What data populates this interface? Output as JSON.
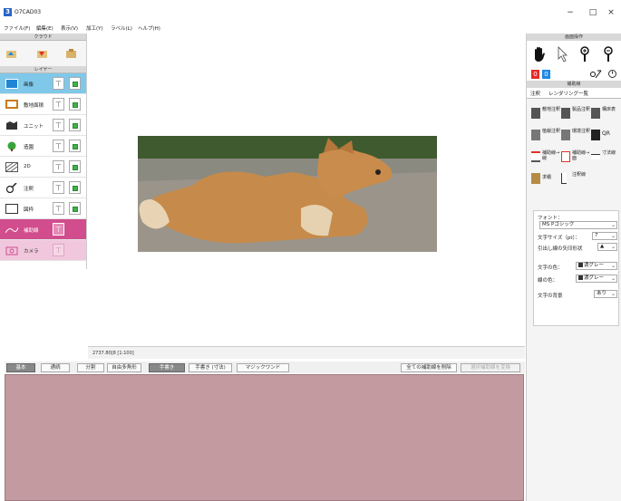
{
  "window": {
    "title": "O7CAD03",
    "icon_text": "3",
    "controls": {
      "minimize": "−",
      "maximize": "□",
      "close": "×"
    }
  },
  "menu": [
    "ファイル(F)",
    "編集(E)",
    "表示(V)",
    "加工(Y)",
    "ラベル(L)",
    "ヘルプ(H)"
  ],
  "left_panel": {
    "cloud_header": "クラウド",
    "cloud_icons": [
      "cloud-upload-icon",
      "cloud-download-icon",
      "cloud-box-icon"
    ],
    "layer_header": "レイヤー",
    "layers": [
      {
        "label": "画像",
        "icon": "image-layer-icon",
        "state": "selected-blue"
      },
      {
        "label": "敷地面積",
        "icon": "site-area-icon",
        "state": "normal"
      },
      {
        "label": "ユニット",
        "icon": "unit-icon",
        "state": "normal"
      },
      {
        "label": "造園",
        "icon": "landscape-icon",
        "state": "normal"
      },
      {
        "label": "2D",
        "icon": "2d-icon",
        "state": "normal"
      },
      {
        "label": "注釈",
        "icon": "annotation-icon",
        "state": "normal"
      },
      {
        "label": "図枠",
        "icon": "frame-icon",
        "state": "normal"
      },
      {
        "label": "補助線",
        "icon": "aux-line-icon",
        "state": "selected-pink"
      },
      {
        "label": "カメラ",
        "icon": "camera-icon",
        "state": "pink-light"
      }
    ],
    "layer_tool_glyph": "⊤"
  },
  "status_bar": {
    "text": "2737.80[8 [1:100]"
  },
  "bottom_toolbar": [
    {
      "label": "基本",
      "style": "dark"
    },
    {
      "label": "通続",
      "style": "normal"
    },
    {
      "label": "分割",
      "style": "normal"
    },
    {
      "label": "自由多角形",
      "style": "normal"
    },
    {
      "label": "手書き",
      "style": "dark"
    },
    {
      "label": "手書き (寸法)",
      "style": "normal"
    },
    {
      "label": "マジックワンド",
      "style": "normal"
    },
    {
      "label": "全ての補助線を削除",
      "style": "normal"
    },
    {
      "label": "選択補助線を変換",
      "style": "disabled"
    }
  ],
  "right_panel": {
    "screen_ops_header": "画面操作",
    "screen_ops": [
      "hand-icon",
      "pointer-icon",
      "zoom-in-icon",
      "zoom-out-icon"
    ],
    "num_badges": [
      {
        "value": "0",
        "color": "#e52a2a"
      },
      {
        "value": "0",
        "color": "#1e88e5"
      }
    ],
    "aux_header": "補助線",
    "tabs": [
      "注釈",
      "レンダリング一覧"
    ],
    "aux_buttons": [
      {
        "label": "敷地注釈"
      },
      {
        "label": "製品注釈"
      },
      {
        "label": "構床表"
      },
      {
        "label": "植栽注釈"
      },
      {
        "label": "環境注釈"
      },
      {
        "label": "QR"
      },
      {
        "label": "補助線→線"
      },
      {
        "label": "補助線→面"
      },
      {
        "label": "寸法線"
      },
      {
        "label": "求積"
      },
      {
        "label": "注釈線"
      }
    ],
    "font_section": {
      "font_label": "フォント：",
      "font_value": "MS Pゴシック",
      "size_label": "文字サイズ（pt）：",
      "size_value": "7",
      "arrow_label": "引出し線の矢印形状",
      "arrow_value": "▲",
      "text_color_label": "文字の色：",
      "text_color_value": "濃グレー",
      "line_color_label": "線の色：",
      "line_color_value": "濃グレー",
      "bg_label": "文字の背景",
      "bg_value": "あり"
    }
  },
  "colors": {
    "layer_selected": "#7fc8ea",
    "aux_line_layer": "#d24d8d",
    "camera_layer": "#f0c7dc",
    "bottom_panel": "#c29aa0"
  }
}
